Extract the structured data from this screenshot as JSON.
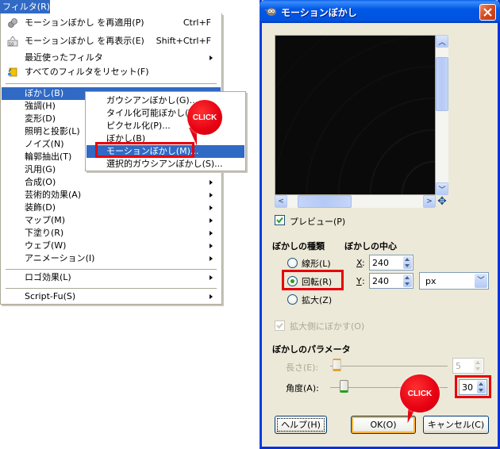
{
  "menubar": {
    "title": "フィルタ",
    "title_mnemonic": "(R)"
  },
  "main_menu": {
    "items": [
      {
        "label": "モーションぼかし を再適用",
        "mnemonic": "(P)",
        "shortcut": "Ctrl+F",
        "icon": "reapply-filter-icon"
      },
      {
        "label": "モーションぼかし を再表示",
        "mnemonic": "(E)",
        "shortcut": "Shift+Ctrl+F",
        "icon": "reshow-filter-icon"
      },
      {
        "label": "最近使ったフィルタ",
        "mnemonic": "",
        "submenu": true
      },
      {
        "label": "すべてのフィルタをリセット",
        "mnemonic": "(F)",
        "icon": "reset-filters-icon"
      },
      {
        "label": "ぼかし",
        "mnemonic": "(B)",
        "submenu": true,
        "active": true
      },
      {
        "label": "強調",
        "mnemonic": "(H)",
        "submenu": true
      },
      {
        "label": "変形",
        "mnemonic": "(D)",
        "submenu": true
      },
      {
        "label": "照明と投影",
        "mnemonic": "(L)",
        "submenu": true
      },
      {
        "label": "ノイズ",
        "mnemonic": "(N)",
        "submenu": true
      },
      {
        "label": "輪郭抽出",
        "mnemonic": "(T)",
        "submenu": true
      },
      {
        "label": "汎用",
        "mnemonic": "(G)",
        "submenu": true
      },
      {
        "label": "合成",
        "mnemonic": "(O)",
        "submenu": true
      },
      {
        "label": "芸術的効果",
        "mnemonic": "(A)",
        "submenu": true
      },
      {
        "label": "装飾",
        "mnemonic": "(D)",
        "submenu": true
      },
      {
        "label": "マップ",
        "mnemonic": "(M)",
        "submenu": true
      },
      {
        "label": "下塗り",
        "mnemonic": "(R)",
        "submenu": true
      },
      {
        "label": "ウェブ",
        "mnemonic": "(W)",
        "submenu": true
      },
      {
        "label": "アニメーション",
        "mnemonic": "(I)",
        "submenu": true
      },
      {
        "label": "ロゴ効果",
        "mnemonic": "(L)",
        "submenu": true
      },
      {
        "label": "Script-Fu",
        "mnemonic": "(S)",
        "submenu": true
      }
    ]
  },
  "blur_submenu": {
    "items": [
      {
        "label": "ガウシアンぼかし",
        "mnemonic": "(G)..."
      },
      {
        "label": "タイル化可能ぼかし",
        "mnemonic": "(T)..."
      },
      {
        "label": "ピクセル化",
        "mnemonic": "(P)..."
      },
      {
        "label": "ぼかし",
        "mnemonic": "(B)"
      },
      {
        "label": "モーションぼかし",
        "mnemonic": "(M)...",
        "active": true
      },
      {
        "label": "選択的ガウシアンぼかし",
        "mnemonic": "(S)..."
      }
    ]
  },
  "annotations": {
    "click_label": "CLICK",
    "highlight_color": "#e8000b"
  },
  "dialog": {
    "title": "モーションぼかし",
    "preview": {
      "label": "プレビュー",
      "mnemonic": "(P)",
      "checked": true
    },
    "blur_type": {
      "heading": "ぼかしの種類",
      "options": [
        {
          "label": "線形",
          "mnemonic": "(L)",
          "selected": false
        },
        {
          "label": "回転",
          "mnemonic": "(R)",
          "selected": true
        },
        {
          "label": "拡大",
          "mnemonic": "(Z)",
          "selected": false
        }
      ]
    },
    "blur_center": {
      "heading": "ぼかしの中心",
      "x_label": "X",
      "x_value": "240",
      "y_label": "Y",
      "y_value": "240",
      "unit": "px"
    },
    "blur_outward": {
      "label": "拡大側にぼかす",
      "mnemonic": "(O)",
      "checked": true,
      "disabled": true
    },
    "params": {
      "heading": "ぼかしのパラメータ",
      "length": {
        "label": "長さ",
        "mnemonic": "(E):",
        "value": "5",
        "disabled": true,
        "slider_fraction": 0.02
      },
      "angle": {
        "label": "角度",
        "mnemonic": "(A):",
        "value": "30",
        "slider_fraction": 0.08
      }
    },
    "buttons": {
      "help": {
        "label": "ヘルプ",
        "mnemonic": "(H)"
      },
      "ok": {
        "label": "OK",
        "mnemonic": "(O)"
      },
      "cancel": {
        "label": "キャンセル",
        "mnemonic": "(C)"
      }
    }
  },
  "colors": {
    "menu_highlight": "#316ac5",
    "xp_title_blue": "#0058e6",
    "dialog_bg": "#ece9d8",
    "check_green": "#21a121"
  }
}
